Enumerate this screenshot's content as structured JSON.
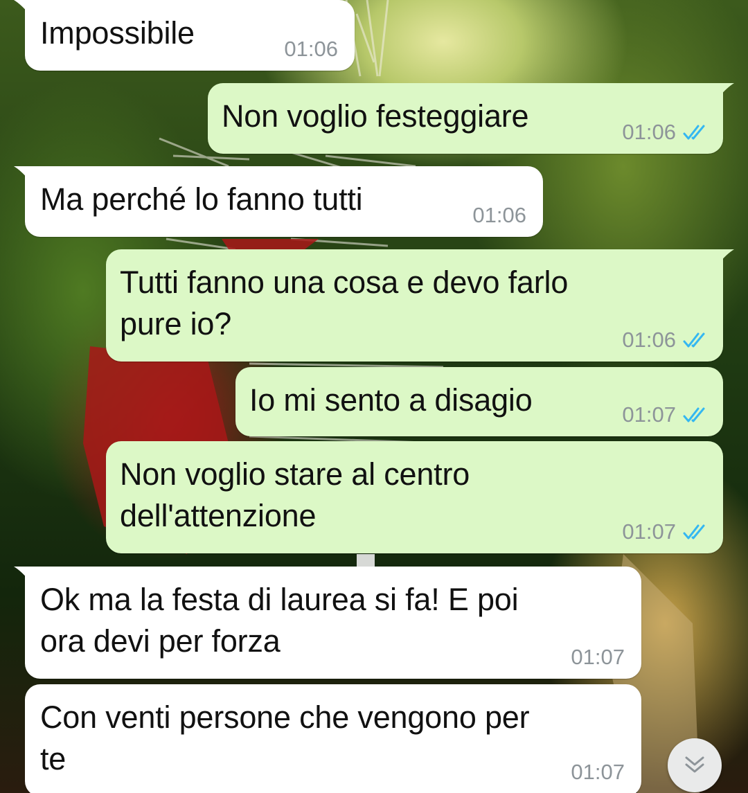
{
  "colors": {
    "incoming_bubble": "#ffffff",
    "outgoing_bubble": "#dcf8c6",
    "timestamp": "#8d9499",
    "read_ticks": "#34b7f1"
  },
  "messages": [
    {
      "direction": "in",
      "text": "Impossibile",
      "time": "01:06"
    },
    {
      "direction": "out",
      "text": "Non voglio festeggiare",
      "time": "01:06",
      "status": "read"
    },
    {
      "direction": "in",
      "text": "Ma perché lo fanno tutti",
      "time": "01:06"
    },
    {
      "direction": "out",
      "text": "Tutti fanno una cosa e devo farlo\npure io?",
      "time": "01:06",
      "status": "read"
    },
    {
      "direction": "out",
      "text": "Io mi sento a disagio",
      "time": "01:07",
      "status": "read"
    },
    {
      "direction": "out",
      "text": "Non voglio stare al centro\ndell'attenzione",
      "time": "01:07",
      "status": "read"
    },
    {
      "direction": "in",
      "text": "Ok ma la festa di laurea si fa! E poi\nora devi per forza",
      "time": "01:07"
    },
    {
      "direction": "in",
      "text": "Con venti persone che vengono per\nte",
      "time": "01:07"
    }
  ],
  "scroll_button": {
    "icon": "double-chevron-down-icon"
  }
}
